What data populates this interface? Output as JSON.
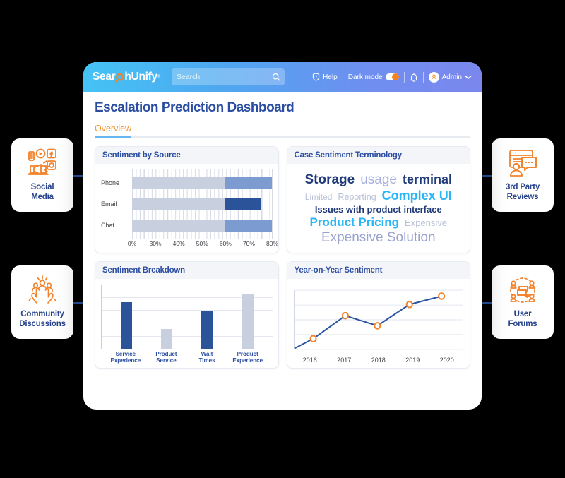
{
  "app": {
    "logo_text_pre": "Sear",
    "logo_icon": "magnifier-c-icon",
    "logo_text_post": "hUnify",
    "logo_registered": "®"
  },
  "search": {
    "placeholder": "Search",
    "value": "",
    "icon": "search-icon"
  },
  "topnav": {
    "help_label": "Help",
    "help_icon": "help-shield-icon",
    "dark_mode_label": "Dark mode",
    "dark_mode_toggle_state": "on",
    "bell_icon": "notification-bell-icon",
    "user_label": "Admin",
    "user_icon": "user-avatar-icon",
    "chevron": "chevron-down-icon"
  },
  "page": {
    "title": "Escalation Prediction Dashboard",
    "tabs": [
      {
        "label": "Overview",
        "active": true
      }
    ]
  },
  "panels": {
    "sentiment_by_source": {
      "title": "Sentiment by Source"
    },
    "case_sentiment_terminology": {
      "title": "Case Sentiment Terminology"
    },
    "sentiment_breakdown": {
      "title": "Sentiment Breakdown"
    },
    "year_on_year": {
      "title": "Year-on-Year Sentiment"
    }
  },
  "side_cards": [
    {
      "id": "social",
      "label_line1": "Social",
      "label_line2": "Media",
      "icon": "social-media-megaphone-icon"
    },
    {
      "id": "community",
      "label_line1": "Community",
      "label_line2": "Discussions",
      "icon": "community-hands-people-icon"
    },
    {
      "id": "reviews",
      "label_line1": "3rd Party",
      "label_line2": "Reviews",
      "icon": "third-party-reviews-icon"
    },
    {
      "id": "forums",
      "label_line1": "User",
      "label_line2": "Forums",
      "icon": "user-forums-icon"
    }
  ],
  "colors": {
    "brand_orange": "#f2922c",
    "brand_navy": "#2b4ea2",
    "bar_dark": "#2a5399",
    "bar_mid": "#7b9bd1",
    "bar_light": "#c8cfdf",
    "cloud_cyan": "#29b6f6",
    "cloud_navy": "#1f3a78",
    "cloud_periwinkle": "#a8aede",
    "cloud_gray": "#b9c0d8",
    "line_stroke": "#2b55a3",
    "marker_stroke": "#f2822c"
  },
  "chart_data": [
    {
      "id": "sentiment-by-source",
      "type": "bar",
      "orientation": "horizontal",
      "title": "Sentiment by Source",
      "categories": [
        "Phone",
        "Email",
        "Chat"
      ],
      "series": [
        {
          "name": "Base",
          "values": [
            60,
            60,
            60
          ],
          "color": "#c8cfdf"
        },
        {
          "name": "Sentiment",
          "values": [
            80,
            75,
            80
          ],
          "color": "#7b9bd1"
        }
      ],
      "values": [
        80,
        75,
        80
      ],
      "bar_colors": [
        "#7b9bd1",
        "#2a5399",
        "#7b9bd1"
      ],
      "tick_labels": [
        "0%",
        "30%",
        "40%",
        "50%",
        "60%",
        "70%",
        "80%"
      ],
      "xlabel": "",
      "ylabel": "",
      "xlim": [
        0,
        80
      ],
      "grid": true
    },
    {
      "id": "case-sentiment-terminology",
      "type": "wordcloud",
      "title": "Case Sentiment Terminology",
      "words": [
        {
          "text": "Storage",
          "size": 19,
          "weight": "bold",
          "color": "#1f3a78"
        },
        {
          "text": "usage",
          "size": 19,
          "weight": "normal",
          "color": "#a8aede"
        },
        {
          "text": "terminal",
          "size": 18,
          "weight": "bold",
          "color": "#1f3a78"
        },
        {
          "text": "Limited",
          "size": 12,
          "weight": "normal",
          "color": "#b9c0d8"
        },
        {
          "text": "Reporting",
          "size": 12.5,
          "weight": "normal",
          "color": "#b9c0d8"
        },
        {
          "text": "Complex UI",
          "size": 18,
          "weight": "bold",
          "color": "#29b6f6"
        },
        {
          "text": "Issues with product interface",
          "size": 13,
          "weight": "bold",
          "color": "#1f3a78"
        },
        {
          "text": "Product Pricing",
          "size": 17,
          "weight": "bold",
          "color": "#29b6f6"
        },
        {
          "text": "Expensive",
          "size": 13,
          "weight": "normal",
          "color": "#b9c0d8"
        },
        {
          "text": "Expensive Solution",
          "size": 19,
          "weight": "normal",
          "color": "#9aa3cf"
        }
      ]
    },
    {
      "id": "sentiment-breakdown",
      "type": "bar",
      "orientation": "vertical",
      "title": "Sentiment Breakdown",
      "categories": [
        "Service Experience",
        "Product Service",
        "Wait Times",
        "Product Experience"
      ],
      "category_lines": [
        [
          "Service",
          "Experience"
        ],
        [
          "Product",
          "Service"
        ],
        [
          "Wait",
          "Times"
        ],
        [
          "Product",
          "Experience"
        ]
      ],
      "values": [
        72,
        31,
        58,
        86
      ],
      "bar_colors": [
        "#2a5399",
        "#c8cfdf",
        "#2a5399",
        "#c8cfdf"
      ],
      "ylim": [
        0,
        100
      ],
      "gridlines": 5,
      "grid": true
    },
    {
      "id": "year-on-year-sentiment",
      "type": "line",
      "title": "Year-on-Year Sentiment",
      "x": [
        "2016",
        "2017",
        "2018",
        "2019",
        "2020"
      ],
      "values": [
        18,
        57,
        40,
        76,
        90
      ],
      "marker": "circle-open",
      "line_color": "#2b55a3",
      "marker_color": "#f2822c",
      "ylim": [
        0,
        100
      ],
      "grid": true
    }
  ]
}
